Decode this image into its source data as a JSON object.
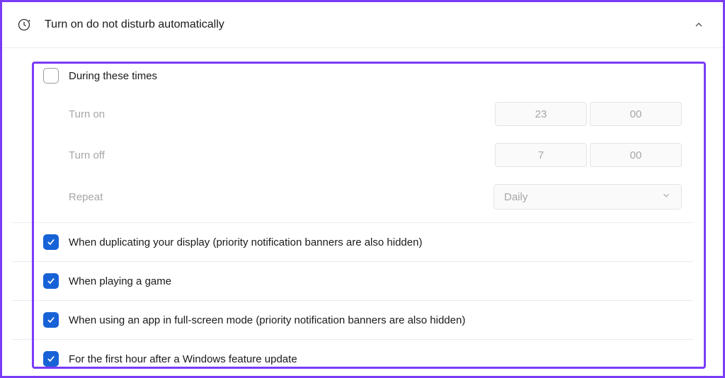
{
  "header": {
    "title": "Turn on do not disturb automatically"
  },
  "duringTimes": {
    "label": "During these times",
    "turnOnLabel": "Turn on",
    "turnOnHour": "23",
    "turnOnMin": "00",
    "turnOffLabel": "Turn off",
    "turnOffHour": "7",
    "turnOffMin": "00",
    "repeatLabel": "Repeat",
    "repeatValue": "Daily"
  },
  "items": [
    "When duplicating your display (priority notification banners are also hidden)",
    "When playing a game",
    "When using an app in full-screen mode (priority notification banners are also hidden)",
    "For the first hour after a Windows feature update"
  ]
}
